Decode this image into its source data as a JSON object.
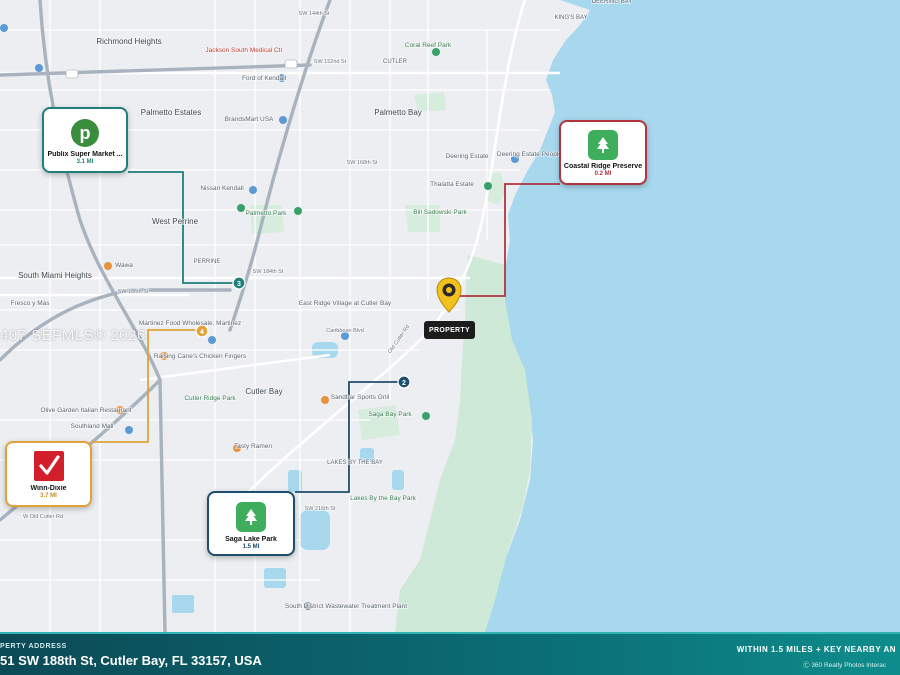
{
  "map": {
    "colors": {
      "water": "#a8d8ee",
      "land": "#eceef1",
      "park": "#cfe9d8",
      "road": "#ffffff",
      "highway": "#a9b3bf",
      "route_teal": "#1f7f7a",
      "route_red": "#b0353f",
      "route_navy": "#1f4d6e",
      "route_gold": "#e0a33a"
    },
    "place_labels": [
      {
        "text": "Richmond Heights",
        "cls": "city"
      },
      {
        "text": "CUTLER",
        "cls": "small"
      },
      {
        "text": "Coral Reef Park",
        "cls": "park"
      },
      {
        "text": "Jackson South Medical Ctr",
        "cls": "poi-red"
      },
      {
        "text": "Ford of Kendall",
        "cls": "poi"
      },
      {
        "text": "Palmetto Estates",
        "cls": "city"
      },
      {
        "text": "BrandsMart USA",
        "cls": "poi"
      },
      {
        "text": "Palmetto Bay",
        "cls": "city"
      },
      {
        "text": "Deering Estate",
        "cls": "poi"
      },
      {
        "text": "Deering Estate People's Dock",
        "cls": "poi"
      },
      {
        "text": "Thalatta Estate",
        "cls": "poi"
      },
      {
        "text": "Nissan Kendall",
        "cls": "poi"
      },
      {
        "text": "Palmetto Park",
        "cls": "park"
      },
      {
        "text": "Bill Sadowski Park",
        "cls": "park"
      },
      {
        "text": "West Perrine",
        "cls": "city"
      },
      {
        "text": "PERRINE",
        "cls": "small"
      },
      {
        "text": "Wawa",
        "cls": "poi"
      },
      {
        "text": "South Miami Heights",
        "cls": "city"
      },
      {
        "text": "Fresco y Más",
        "cls": "poi"
      },
      {
        "text": "Martinez Food Wholesale, Martinez",
        "cls": "poi"
      },
      {
        "text": "East Ridge Village at Cutler Bay",
        "cls": "poi"
      },
      {
        "text": "Raising Cane's Chicken Fingers",
        "cls": "poi"
      },
      {
        "text": "Cutler Bay",
        "cls": "city"
      },
      {
        "text": "Cutler Ridge Park",
        "cls": "park"
      },
      {
        "text": "Sandbar Sports Grill",
        "cls": "poi"
      },
      {
        "text": "Saga Bay Park",
        "cls": "park"
      },
      {
        "text": "Olive Garden Italian Restaurant",
        "cls": "poi"
      },
      {
        "text": "Southland Mall",
        "cls": "poi"
      },
      {
        "text": "Tasty Ramen",
        "cls": "poi"
      },
      {
        "text": "LAKES BY THE BAY",
        "cls": "small"
      },
      {
        "text": "Lakes By the Bay Park",
        "cls": "park"
      },
      {
        "text": "South District Wastewater Treatment Plant",
        "cls": "poi"
      },
      {
        "text": "Old Cutler Rd",
        "cls": "street"
      },
      {
        "text": "SW 144th St",
        "cls": "street"
      },
      {
        "text": "SW 152nd St",
        "cls": "street"
      },
      {
        "text": "SW 168th St",
        "cls": "street"
      },
      {
        "text": "SW 184th St",
        "cls": "street"
      },
      {
        "text": "SW 186th St",
        "cls": "street"
      },
      {
        "text": "SW 216th St",
        "cls": "street"
      },
      {
        "text": "Caribbean Blvd",
        "cls": "street"
      },
      {
        "text": "W Old Cutler Rd",
        "cls": "street"
      },
      {
        "text": "KING'S BAY",
        "cls": "small"
      },
      {
        "text": "DEERING BAY",
        "cls": "small"
      }
    ]
  },
  "destinations": [
    {
      "id": "publix",
      "name": "Publix Super Market ...",
      "distance": "3.1 MI",
      "icon": "publix-logo-icon",
      "accent": "#1f7f7a"
    },
    {
      "id": "coastal",
      "name": "Coastal Ridge Preserve",
      "distance": "0.2 MI",
      "icon": "tree-icon",
      "accent": "#b0353f"
    },
    {
      "id": "winn",
      "name": "Winn-Dixie",
      "distance": "3.7 MI",
      "icon": "check-logo-icon",
      "accent": "#e0a33a"
    },
    {
      "id": "saga",
      "name": "Saga Lake Park",
      "distance": "1.5 MI",
      "icon": "tree-icon",
      "accent": "#1f4d6e"
    }
  ],
  "route_markers": [
    "2",
    "3",
    "4"
  ],
  "property": {
    "tag": "PROPERTY",
    "icon": "property-pin-icon"
  },
  "watermark": "407 SEFMLS© 2026",
  "footer": {
    "label": "PERTY ADDRESS",
    "address": "51 SW 188th St, Cutler Bay, FL 33157, USA",
    "summary": "WITHIN 1.5 MILES + KEY NEARBY AN",
    "credit": "360 Realty Photos Interac"
  }
}
